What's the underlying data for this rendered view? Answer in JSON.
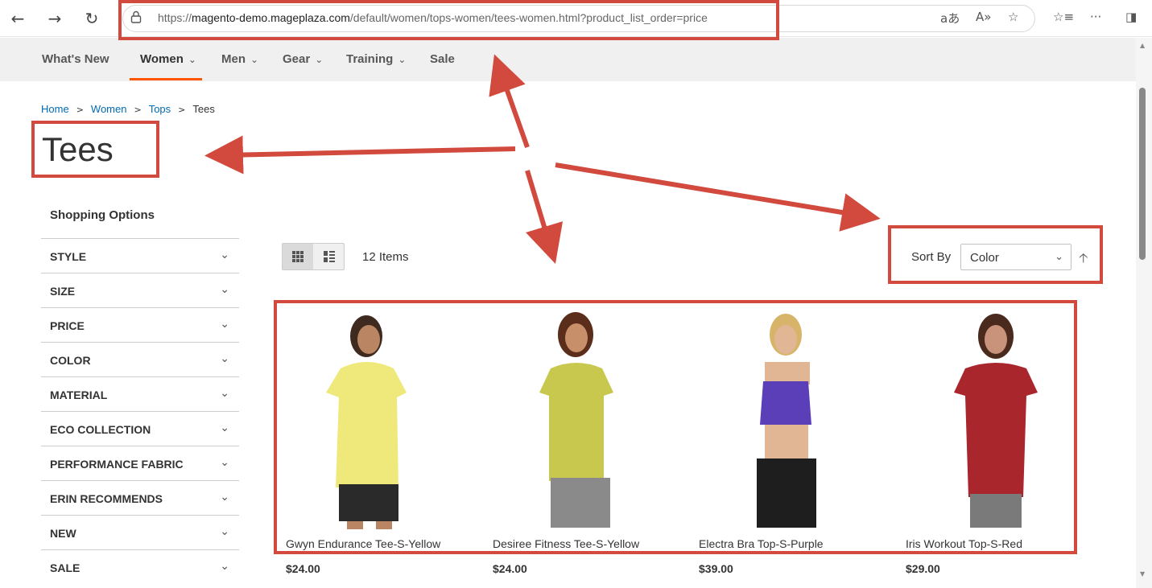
{
  "browser": {
    "url_prefix": "https://",
    "url_domain": "magento-demo.mageplaza.com",
    "url_path": "/default/women/tops-women/tees-women.html?product_list_order=price"
  },
  "nav": [
    {
      "label": "What's New",
      "has_menu": false
    },
    {
      "label": "Women",
      "has_menu": true,
      "active": true
    },
    {
      "label": "Men",
      "has_menu": true
    },
    {
      "label": "Gear",
      "has_menu": true
    },
    {
      "label": "Training",
      "has_menu": true
    },
    {
      "label": "Sale",
      "has_menu": false
    }
  ],
  "breadcrumbs": [
    "Home",
    "Women",
    "Tops",
    "Tees"
  ],
  "page_title": "Tees",
  "sidebar": {
    "title": "Shopping Options",
    "filters": [
      "STYLE",
      "SIZE",
      "PRICE",
      "COLOR",
      "MATERIAL",
      "ECO COLLECTION",
      "PERFORMANCE FABRIC",
      "ERIN RECOMMENDS",
      "NEW",
      "SALE"
    ]
  },
  "toolbar": {
    "item_count": "12 Items",
    "sort_label": "Sort By",
    "sort_value": "Color"
  },
  "products": [
    {
      "name": "Gwyn Endurance Tee-S-Yellow",
      "price": "$24.00",
      "top_color": "#efe97c",
      "bottom_color": "#2a2a2a"
    },
    {
      "name": "Desiree Fitness Tee-S-Yellow",
      "price": "$24.00",
      "top_color": "#c8c84e",
      "bottom_color": "#8a8a8a"
    },
    {
      "name": "Electra Bra Top-S-Purple",
      "price": "$39.00",
      "top_color": "#5a3fb8",
      "bottom_color": "#1e1e1e"
    },
    {
      "name": "Iris Workout Top-S-Red",
      "price": "$29.00",
      "top_color": "#a8262c",
      "bottom_color": "#7a7a7a"
    }
  ],
  "colors": {
    "annotation": "#d24a3e",
    "link": "#006bb4",
    "nav_active": "#ff5501"
  }
}
